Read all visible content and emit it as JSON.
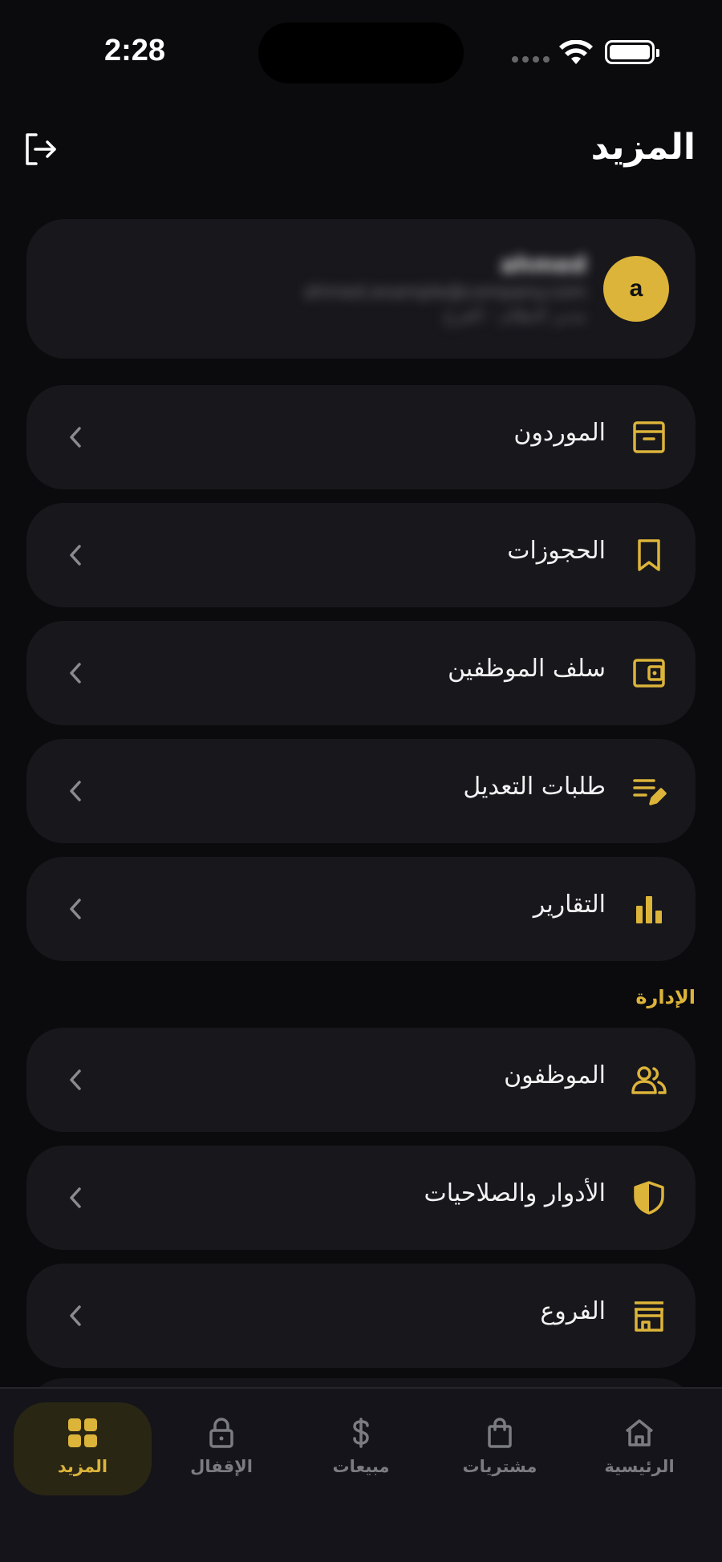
{
  "status_bar": {
    "time": "2:28"
  },
  "header": {
    "title": "المزيد"
  },
  "profile": {
    "initial": "a",
    "name": "ahmed",
    "email": "ahmed.example@company.com",
    "role": "مدير النظام - الفرع"
  },
  "menu": [
    {
      "label": "الموردون",
      "icon": "archive-icon"
    },
    {
      "label": "الحجوزات",
      "icon": "bookmark-icon"
    },
    {
      "label": "سلف الموظفين",
      "icon": "wallet-icon"
    },
    {
      "label": "طلبات التعديل",
      "icon": "edit-list-icon"
    },
    {
      "label": "التقارير",
      "icon": "bar-chart-icon"
    }
  ],
  "admin_section": {
    "title": "الإدارة",
    "items": [
      {
        "label": "الموظفون",
        "icon": "users-icon"
      },
      {
        "label": "الأدوار والصلاحيات",
        "icon": "shield-icon"
      },
      {
        "label": "الفروع",
        "icon": "store-icon"
      }
    ]
  },
  "bottom_nav": [
    {
      "label": "المزيد",
      "icon": "grid-icon",
      "active": true
    },
    {
      "label": "الإقفال",
      "icon": "lock-icon",
      "active": false
    },
    {
      "label": "مبيعات",
      "icon": "dollar-icon",
      "active": false
    },
    {
      "label": "مشتريات",
      "icon": "shopping-bag-icon",
      "active": false
    },
    {
      "label": "الرئيسية",
      "icon": "home-icon",
      "active": false
    }
  ],
  "colors": {
    "accent": "#dcb43a",
    "background": "#0b0b0e",
    "card": "#17171c"
  }
}
